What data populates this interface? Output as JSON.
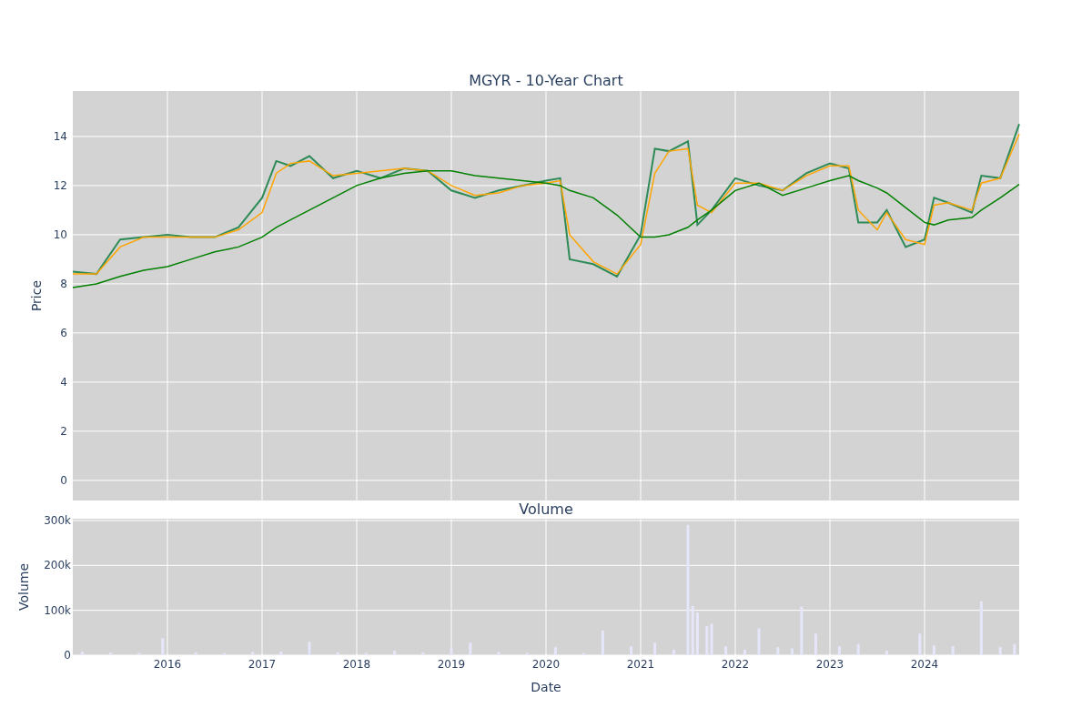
{
  "price_chart": {
    "chart_data": {
      "type": "line",
      "grid": true,
      "title": "MGYR - 10-Year Chart",
      "ylabel": "Price",
      "xlim": [
        2015,
        2025
      ],
      "ylim": [
        -0.82,
        15.85
      ],
      "yticks": [
        0,
        2,
        4,
        6,
        8,
        10,
        12,
        14
      ],
      "x": [
        2015.0,
        2015.25,
        2015.5,
        2015.75,
        2016.0,
        2016.25,
        2016.5,
        2016.75,
        2017.0,
        2017.15,
        2017.3,
        2017.5,
        2017.75,
        2018.0,
        2018.25,
        2018.5,
        2018.75,
        2019.0,
        2019.25,
        2019.5,
        2019.75,
        2020.0,
        2020.15,
        2020.25,
        2020.5,
        2020.75,
        2021.0,
        2021.15,
        2021.3,
        2021.5,
        2021.6,
        2021.75,
        2022.0,
        2022.25,
        2022.5,
        2022.75,
        2023.0,
        2023.2,
        2023.3,
        2023.5,
        2023.6,
        2023.8,
        2024.0,
        2024.1,
        2024.25,
        2024.5,
        2024.6,
        2024.8,
        2025.0
      ],
      "series": [
        {
          "color": "#2e8b57",
          "values": [
            8.5,
            8.4,
            9.8,
            9.9,
            10.0,
            9.9,
            9.9,
            10.3,
            11.5,
            13.0,
            12.8,
            13.2,
            12.3,
            12.6,
            12.3,
            12.7,
            12.6,
            11.8,
            11.5,
            11.8,
            12.0,
            12.2,
            12.3,
            9.0,
            8.8,
            8.3,
            10.0,
            13.5,
            13.4,
            13.8,
            10.4,
            11.0,
            12.3,
            12.0,
            11.8,
            12.5,
            12.9,
            12.7,
            10.5,
            10.5,
            11.0,
            9.5,
            9.8,
            11.5,
            11.3,
            10.9,
            12.4,
            12.3,
            14.5
          ]
        },
        {
          "color": "#ffa500",
          "values": [
            8.4,
            8.4,
            9.5,
            9.9,
            9.9,
            9.9,
            9.9,
            10.2,
            10.9,
            12.5,
            12.9,
            13.0,
            12.4,
            12.5,
            12.6,
            12.7,
            12.6,
            12.0,
            11.6,
            11.7,
            12.0,
            12.1,
            12.2,
            10.0,
            8.9,
            8.4,
            9.6,
            12.5,
            13.4,
            13.5,
            11.2,
            10.9,
            12.1,
            12.1,
            11.8,
            12.4,
            12.8,
            12.8,
            11.0,
            10.2,
            10.9,
            9.8,
            9.6,
            11.2,
            11.3,
            11.0,
            12.1,
            12.3,
            14.1
          ]
        },
        {
          "color": "#008000",
          "values": [
            7.85,
            8.0,
            8.3,
            8.55,
            8.7,
            9.0,
            9.3,
            9.5,
            9.9,
            10.3,
            10.6,
            11.0,
            11.5,
            12.0,
            12.3,
            12.5,
            12.6,
            12.6,
            12.4,
            12.3,
            12.2,
            12.1,
            12.0,
            11.8,
            11.5,
            10.8,
            9.9,
            9.9,
            10.0,
            10.3,
            10.6,
            11.0,
            11.8,
            12.1,
            11.6,
            11.9,
            12.2,
            12.4,
            12.2,
            11.9,
            11.7,
            11.1,
            10.5,
            10.4,
            10.6,
            10.7,
            11.0,
            11.5,
            12.05
          ]
        }
      ]
    }
  },
  "volume_chart": {
    "chart_data": {
      "type": "bar",
      "grid": true,
      "title": "Volume",
      "xlabel": "Date",
      "ylabel": "Volume",
      "xlim": [
        2015,
        2025
      ],
      "ylim": [
        0,
        304000
      ],
      "xticks": [
        2016,
        2017,
        2018,
        2019,
        2020,
        2021,
        2022,
        2023,
        2024
      ],
      "yticks": [
        {
          "value": 0,
          "label": "0"
        },
        {
          "value": 100000,
          "label": "100k"
        },
        {
          "value": 200000,
          "label": "200k"
        },
        {
          "value": 300000,
          "label": "300k"
        }
      ],
      "x": [
        2015.1,
        2015.4,
        2015.7,
        2015.95,
        2016.3,
        2016.6,
        2016.9,
        2017.2,
        2017.5,
        2017.8,
        2018.1,
        2018.4,
        2018.7,
        2019.0,
        2019.2,
        2019.5,
        2019.8,
        2020.1,
        2020.4,
        2020.6,
        2020.9,
        2021.15,
        2021.35,
        2021.5,
        2021.55,
        2021.6,
        2021.7,
        2021.75,
        2021.9,
        2022.1,
        2022.25,
        2022.45,
        2022.6,
        2022.7,
        2022.85,
        2023.1,
        2023.3,
        2023.6,
        2023.95,
        2024.1,
        2024.3,
        2024.6,
        2024.8,
        2024.95
      ],
      "series": [
        {
          "color": "#e6e6fa",
          "values": [
            8000,
            6000,
            5000,
            38000,
            6000,
            5000,
            7000,
            8000,
            30000,
            6000,
            5000,
            10000,
            6000,
            15000,
            28000,
            7000,
            5000,
            18000,
            5000,
            55000,
            20000,
            28000,
            12000,
            290000,
            110000,
            95000,
            65000,
            70000,
            20000,
            12000,
            60000,
            18000,
            15000,
            108000,
            48000,
            20000,
            25000,
            10000,
            48000,
            22000,
            20000,
            120000,
            18000,
            25000
          ]
        }
      ]
    }
  }
}
